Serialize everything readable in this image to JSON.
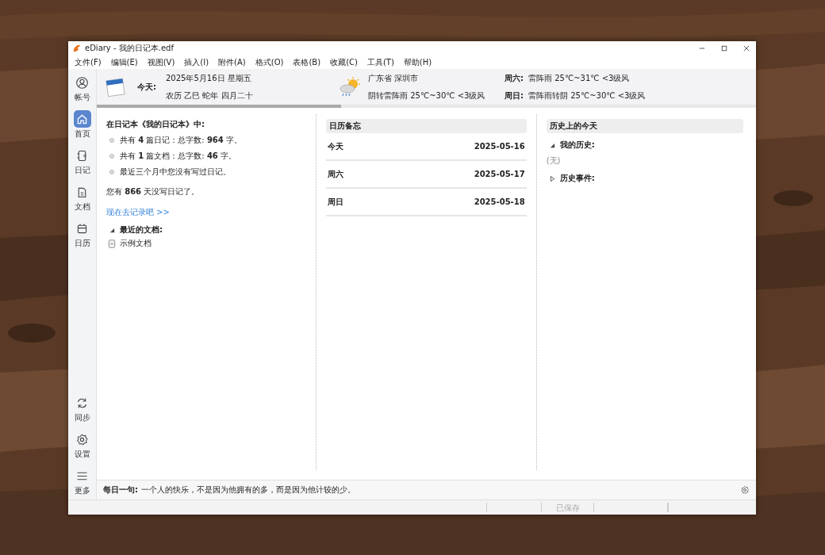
{
  "window": {
    "title": "eDiary - 我的日记本.edf"
  },
  "menu": [
    "文件(F)",
    "编辑(E)",
    "视图(V)",
    "插入(I)",
    "附件(A)",
    "格式(O)",
    "表格(B)",
    "收藏(C)",
    "工具(T)",
    "帮助(H)"
  ],
  "sidebar": {
    "items": [
      {
        "label": "帐号",
        "selected": false
      },
      {
        "label": "首页",
        "selected": true
      },
      {
        "label": "日记",
        "selected": false
      },
      {
        "label": "文档",
        "selected": false
      },
      {
        "label": "日历",
        "selected": false
      }
    ],
    "bottom_items": [
      {
        "label": "同步"
      },
      {
        "label": "设置"
      },
      {
        "label": "更多"
      }
    ]
  },
  "header": {
    "today_label": "今天:",
    "date": "2025年5月16日 星期五",
    "lunar": "农历 乙巳 蛇年 四月二十",
    "location": "广东省 深圳市",
    "weather": "阴转雷阵雨 25℃~30℃ <3级风",
    "forecast": [
      {
        "day": "周六:",
        "weather": "雷阵雨 25℃~31℃ <3级风"
      },
      {
        "day": "周日:",
        "weather": "雷阵雨转阴 25℃~30℃ <3级风"
      }
    ]
  },
  "summary": {
    "title": "在日记本《我的日记本》中:",
    "bullets": [
      "共有 **4** 篇日记：总字数: **964** 字。",
      "共有 **1** 篇文档：总字数: **46** 字。",
      "最近三个月中您没有写过日记。"
    ],
    "days_note": "您有 **866** 天没写日记了。",
    "link": "现在去记录吧 >>",
    "recent": {
      "label": "最近的文档:",
      "expanded": true,
      "items": [
        "示例文档"
      ]
    }
  },
  "calendar_memo": {
    "title": "日历备忘",
    "rows": [
      {
        "day": "今天",
        "date": "2025-05-16"
      },
      {
        "day": "周六",
        "date": "2025-05-17"
      },
      {
        "day": "周日",
        "date": "2025-05-18"
      }
    ]
  },
  "history": {
    "title": "历史上的今天",
    "sections": [
      {
        "label": "我的历史:",
        "expanded": true,
        "items": [
          "(无)"
        ]
      },
      {
        "label": "历史事件:",
        "expanded": false
      }
    ]
  },
  "quote": {
    "label": "每日一句:",
    "text": "一个人的快乐，不是因为他拥有的多，而是因为他计较的少。"
  },
  "status_bar": {
    "saved": "已保存"
  }
}
